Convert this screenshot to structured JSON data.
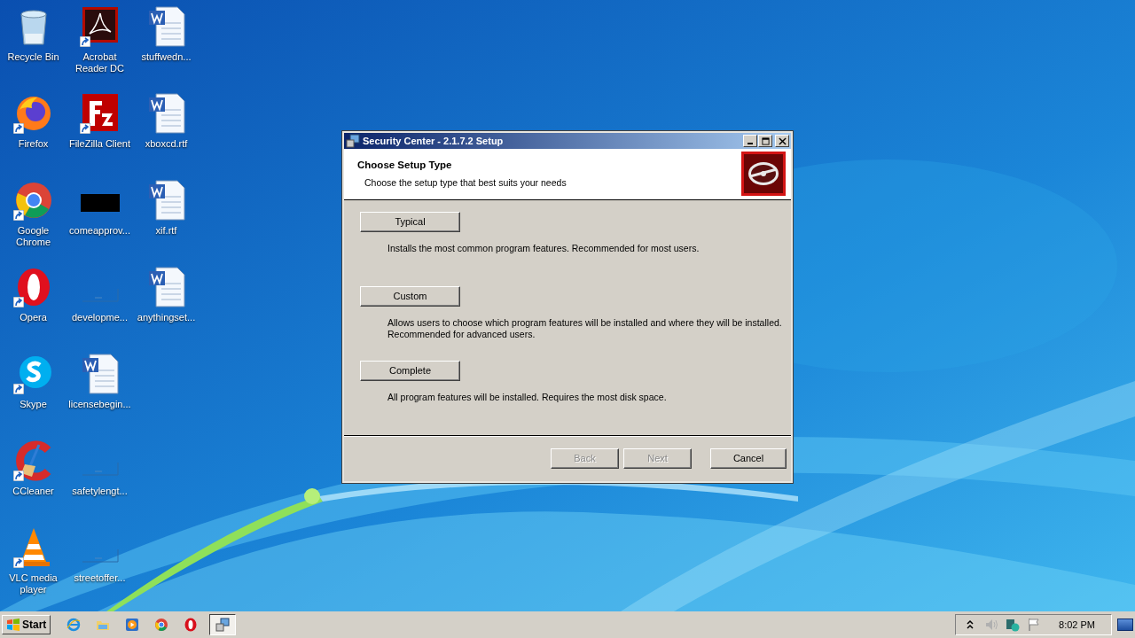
{
  "desktop": {
    "icons": [
      {
        "label": "Recycle Bin",
        "kind": "recycle",
        "shortcut": false
      },
      {
        "label": "Firefox",
        "kind": "firefox",
        "shortcut": true
      },
      {
        "label": "Google Chrome",
        "kind": "chrome",
        "shortcut": true
      },
      {
        "label": "Opera",
        "kind": "opera",
        "shortcut": true
      },
      {
        "label": "Skype",
        "kind": "skype",
        "shortcut": true
      },
      {
        "label": "CCleaner",
        "kind": "ccleaner",
        "shortcut": true
      },
      {
        "label": "VLC media player",
        "kind": "vlc",
        "shortcut": true
      },
      {
        "label": "Acrobat Reader DC",
        "kind": "acrobat",
        "shortcut": true
      },
      {
        "label": "FileZilla Client",
        "kind": "filezilla",
        "shortcut": true
      },
      {
        "label": "comeapprov...",
        "kind": "thumb",
        "shortcut": false
      },
      {
        "label": "developme...",
        "kind": "blank",
        "shortcut": false
      },
      {
        "label": "licensebegin...",
        "kind": "word",
        "shortcut": false
      },
      {
        "label": "safetylengt...",
        "kind": "blank",
        "shortcut": false
      },
      {
        "label": "streetoffer...",
        "kind": "blank",
        "shortcut": false
      },
      {
        "label": "stuffwedn...",
        "kind": "word",
        "shortcut": false
      },
      {
        "label": "xboxcd.rtf",
        "kind": "word",
        "shortcut": false
      },
      {
        "label": "xif.rtf",
        "kind": "word",
        "shortcut": false
      },
      {
        "label": "anythingset...",
        "kind": "word",
        "shortcut": false
      }
    ]
  },
  "dialog": {
    "title": "Security Center - 2.1.7.2 Setup",
    "heading": "Choose Setup Type",
    "subheading": "Choose the setup type that best suits your needs",
    "options": [
      {
        "label": "Typical",
        "description": "Installs the most common program features. Recommended for most users."
      },
      {
        "label": "Custom",
        "description": "Allows users to choose which program features will be installed and where they will be installed. Recommended for advanced users."
      },
      {
        "label": "Complete",
        "description": "All program features will be installed. Requires the most disk space."
      }
    ],
    "buttons": [
      {
        "label": "Back",
        "disabled": true
      },
      {
        "label": "Next",
        "disabled": true
      },
      {
        "label": "Cancel",
        "disabled": false
      }
    ]
  },
  "taskbar": {
    "start": "Start",
    "items": [
      {
        "kind": "ie",
        "selected": false
      },
      {
        "kind": "folder",
        "selected": false
      },
      {
        "kind": "media",
        "selected": false
      },
      {
        "kind": "chrome",
        "selected": false
      },
      {
        "kind": "opera",
        "selected": false
      },
      {
        "kind": "installer",
        "selected": true
      }
    ],
    "clock": "8:02 PM"
  }
}
